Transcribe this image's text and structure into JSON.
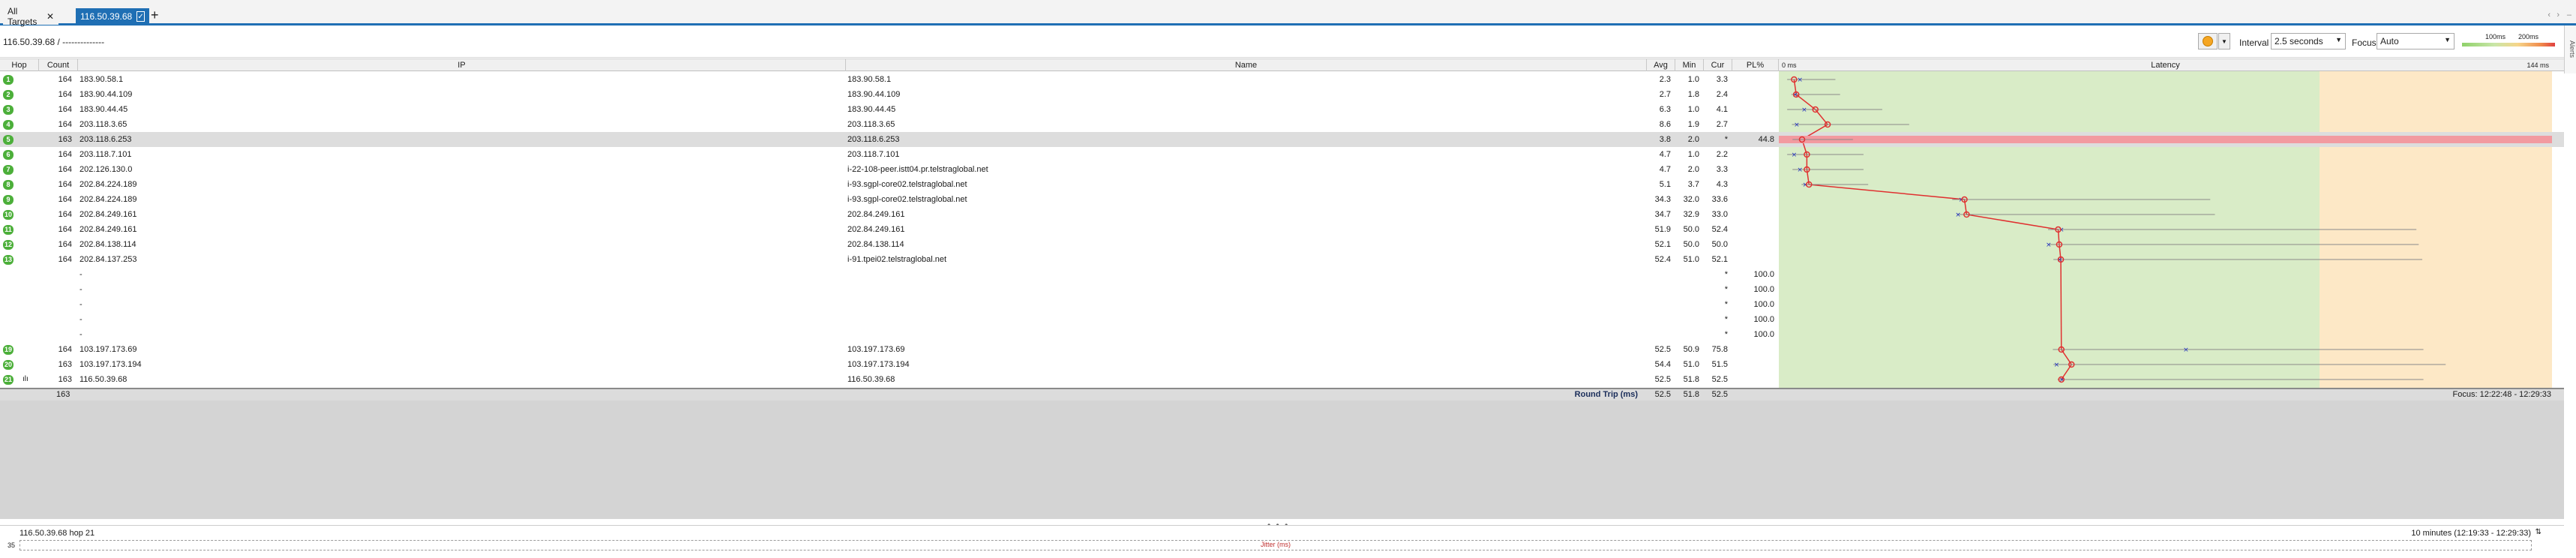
{
  "tabs": [
    {
      "label": "All Targets"
    },
    {
      "label": "116.50.39.68"
    }
  ],
  "toolbar": {
    "target_title": "116.50.39.68 / --------------",
    "interval_label": "Interval",
    "interval_value": "2.5 seconds",
    "focus_label": "Focus",
    "focus_value": "Auto",
    "scale_100": "100ms",
    "scale_200": "200ms",
    "alerts_label": "Alerts"
  },
  "columns": {
    "hop": "Hop",
    "count": "Count",
    "ip": "IP",
    "name": "Name",
    "avg": "Avg",
    "min": "Min",
    "cur": "Cur",
    "pl": "PL%",
    "latency": "Latency",
    "lat_min": "0 ms",
    "lat_max": "144 ms"
  },
  "hops": [
    {
      "hop": "1",
      "count": "164",
      "ip": "183.90.58.1",
      "name": "183.90.58.1",
      "avg": "2.3",
      "min": "1.0",
      "cur": "3.3",
      "pl": ""
    },
    {
      "hop": "2",
      "count": "164",
      "ip": "183.90.44.109",
      "name": "183.90.44.109",
      "avg": "2.7",
      "min": "1.8",
      "cur": "2.4",
      "pl": ""
    },
    {
      "hop": "3",
      "count": "164",
      "ip": "183.90.44.45",
      "name": "183.90.44.45",
      "avg": "6.3",
      "min": "1.0",
      "cur": "4.1",
      "pl": ""
    },
    {
      "hop": "4",
      "count": "164",
      "ip": "203.118.3.65",
      "name": "203.118.3.65",
      "avg": "8.6",
      "min": "1.9",
      "cur": "2.7",
      "pl": ""
    },
    {
      "hop": "5",
      "count": "163",
      "ip": "203.118.6.253",
      "name": "203.118.6.253",
      "avg": "3.8",
      "min": "2.0",
      "cur": "*",
      "pl": "44.8"
    },
    {
      "hop": "6",
      "count": "164",
      "ip": "203.118.7.101",
      "name": "203.118.7.101",
      "avg": "4.7",
      "min": "1.0",
      "cur": "2.2",
      "pl": ""
    },
    {
      "hop": "7",
      "count": "164",
      "ip": "202.126.130.0",
      "name": "i-22-108-peer.istt04.pr.telstraglobal.net",
      "avg": "4.7",
      "min": "2.0",
      "cur": "3.3",
      "pl": ""
    },
    {
      "hop": "8",
      "count": "164",
      "ip": "202.84.224.189",
      "name": "i-93.sgpl-core02.telstraglobal.net",
      "avg": "5.1",
      "min": "3.7",
      "cur": "4.3",
      "pl": ""
    },
    {
      "hop": "9",
      "count": "164",
      "ip": "202.84.224.189",
      "name": "i-93.sgpl-core02.telstraglobal.net",
      "avg": "34.3",
      "min": "32.0",
      "cur": "33.6",
      "pl": ""
    },
    {
      "hop": "10",
      "count": "164",
      "ip": "202.84.249.161",
      "name": "202.84.249.161",
      "avg": "34.7",
      "min": "32.9",
      "cur": "33.0",
      "pl": ""
    },
    {
      "hop": "11",
      "count": "164",
      "ip": "202.84.249.161",
      "name": "202.84.249.161",
      "avg": "51.9",
      "min": "50.0",
      "cur": "52.4",
      "pl": ""
    },
    {
      "hop": "12",
      "count": "164",
      "ip": "202.84.138.114",
      "name": "202.84.138.114",
      "avg": "52.1",
      "min": "50.0",
      "cur": "50.0",
      "pl": ""
    },
    {
      "hop": "13",
      "count": "164",
      "ip": "202.84.137.253",
      "name": "i-91.tpei02.telstraglobal.net",
      "avg": "52.4",
      "min": "51.0",
      "cur": "52.1",
      "pl": ""
    },
    {
      "hop": "",
      "count": "",
      "ip": "-",
      "name": "",
      "avg": "",
      "min": "",
      "cur": "*",
      "pl": "100.0"
    },
    {
      "hop": "",
      "count": "",
      "ip": "-",
      "name": "",
      "avg": "",
      "min": "",
      "cur": "*",
      "pl": "100.0"
    },
    {
      "hop": "",
      "count": "",
      "ip": "-",
      "name": "",
      "avg": "",
      "min": "",
      "cur": "*",
      "pl": "100.0"
    },
    {
      "hop": "",
      "count": "",
      "ip": "-",
      "name": "",
      "avg": "",
      "min": "",
      "cur": "*",
      "pl": "100.0"
    },
    {
      "hop": "",
      "count": "",
      "ip": "-",
      "name": "",
      "avg": "",
      "min": "",
      "cur": "*",
      "pl": "100.0"
    },
    {
      "hop": "19",
      "count": "164",
      "ip": "103.197.173.69",
      "name": "103.197.173.69",
      "avg": "52.5",
      "min": "50.9",
      "cur": "75.8",
      "pl": ""
    },
    {
      "hop": "20",
      "count": "163",
      "ip": "103.197.173.194",
      "name": "103.197.173.194",
      "avg": "54.4",
      "min": "51.0",
      "cur": "51.5",
      "pl": ""
    },
    {
      "hop": "21",
      "count": "163",
      "ip": "116.50.39.68",
      "name": "116.50.39.68",
      "avg": "52.5",
      "min": "51.8",
      "cur": "52.5",
      "pl": ""
    }
  ],
  "totals": {
    "count": "163",
    "label": "Round Trip (ms)",
    "avg": "52.5",
    "min": "51.8",
    "cur": "52.5",
    "focus_range": "Focus: 12:22:48 - 12:29:33"
  },
  "bottom": {
    "left_label": "116.50.39.68 hop 21",
    "right_label": "10 minutes (12:19:33 - 12:29:33)",
    "axis_value": "35",
    "jitter_label": "Jitter (ms)"
  },
  "colors": {
    "accent": "#1f6fb4",
    "hop_badge": "#4caf3a",
    "latency_line": "#e03030",
    "latency_good": "#d9ecc7",
    "latency_warn": "#fde8c6",
    "packet_loss": "#f29aa0"
  }
}
